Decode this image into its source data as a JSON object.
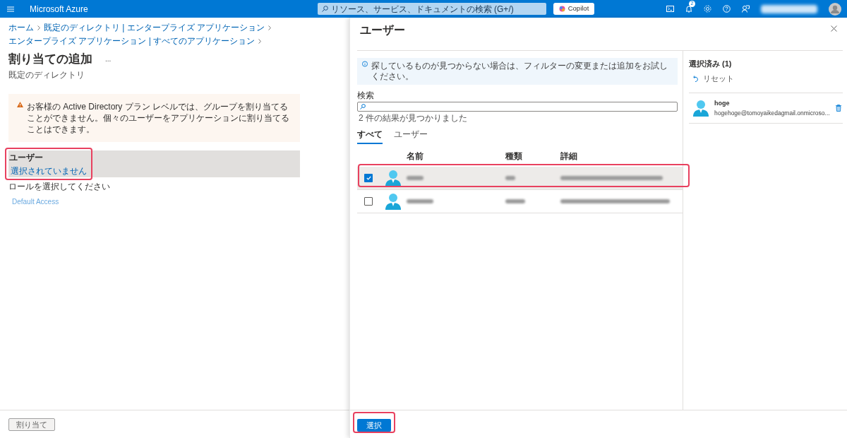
{
  "topbar": {
    "brand": "Microsoft Azure",
    "search_placeholder": "リソース、サービス、ドキュメントの検索 (G+/)",
    "copilot": "Copilot",
    "notification_count": "2"
  },
  "breadcrumb": [
    "ホーム",
    "既定のディレクトリ | エンタープライズ アプリケーション",
    "エンタープライズ アプリケーション | すべてのアプリケーション"
  ],
  "page": {
    "title": "割り当ての追加",
    "more": "...",
    "subtitle": "既定のディレクトリ",
    "warning": "お客様の Active Directory プラン レベルでは、グループを割り当てることができません。個々のユーザーをアプリケーションに割り当てることはできます。",
    "users_label": "ユーザー",
    "users_value": "選択されていません",
    "role_label": "ロールを選択してください",
    "role_value": "Default Access",
    "assign_button": {
      "label": "割り当て",
      "disabled": true
    }
  },
  "panel": {
    "title": "ユーザー",
    "info": "探しているものが見つからない場合は、フィルターの変更または追加をお試しください。",
    "search_label": "検索",
    "result_count": "2 件の結果が見つかりました",
    "tabs": [
      {
        "label": "すべて",
        "selected": true
      },
      {
        "label": "ユーザー",
        "selected": false
      }
    ],
    "columns": [
      "名前",
      "種類",
      "詳細"
    ],
    "rows": [
      {
        "checked": true,
        "selected": true
      },
      {
        "checked": false,
        "selected": false
      }
    ],
    "selected_title": "選択済み (1)",
    "reset": "リセット",
    "selected_items": [
      {
        "name": "hoge",
        "email": "hogehoge@tomoyaikedagmail.onmicroso..."
      }
    ],
    "select_button": "選択"
  }
}
